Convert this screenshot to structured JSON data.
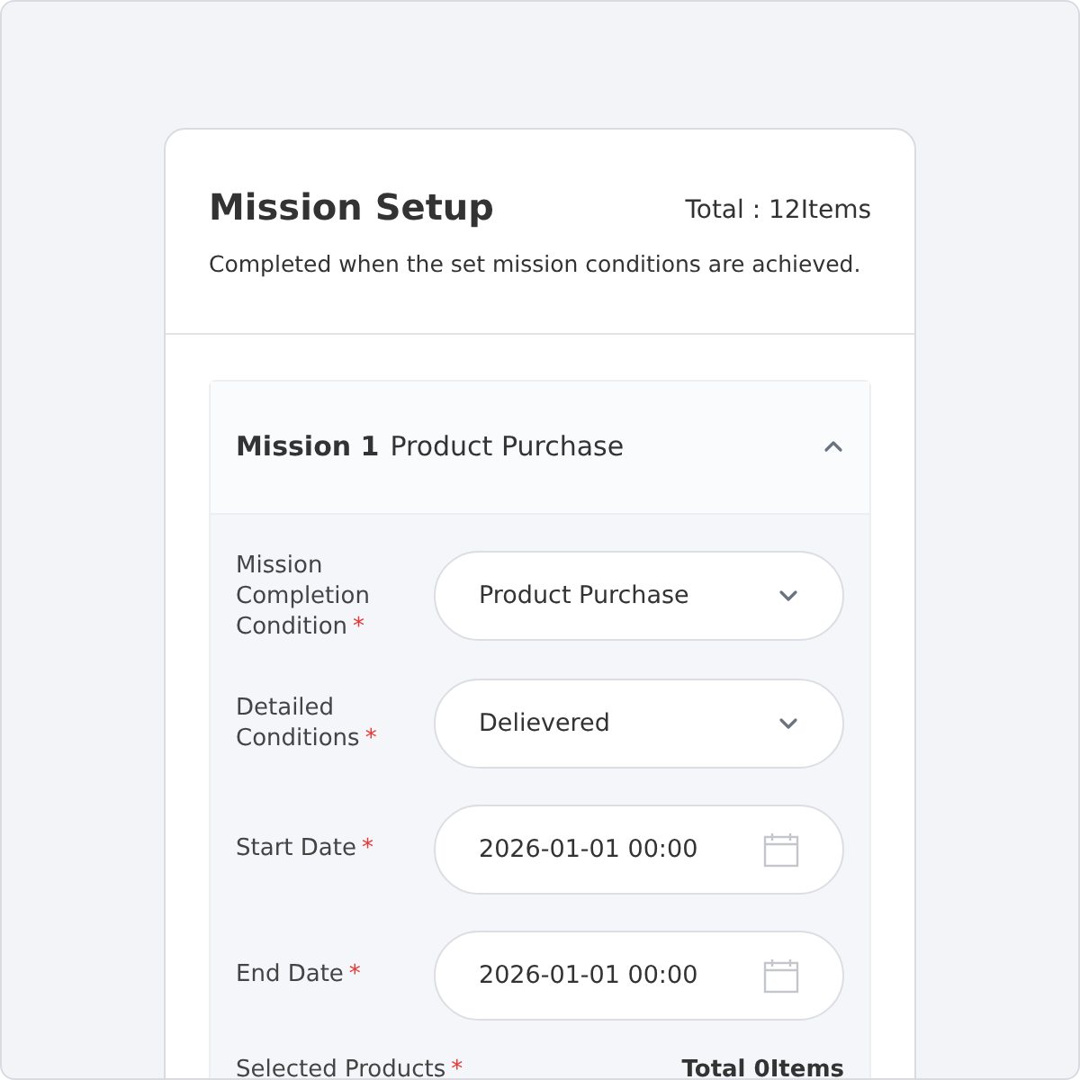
{
  "card": {
    "title": "Mission Setup",
    "total": "Total : 12Items",
    "description": "Completed when the set mission conditions are achieved."
  },
  "mission": {
    "number": "Mission 1",
    "name": "Product Purchase",
    "expanded": true,
    "fields": [
      {
        "kind": "select",
        "label": "Mission Completion Condition",
        "required_mark": "*",
        "value": "Product Purchase"
      },
      {
        "kind": "select",
        "label": "Detailed Conditions",
        "required_mark": "*",
        "value": "Delievered"
      },
      {
        "kind": "date",
        "label": "Start Date",
        "required_mark": "*",
        "value": "2026-01-01 00:00"
      },
      {
        "kind": "date",
        "label": "End Date",
        "required_mark": "*",
        "value": "2026-01-01 00:00"
      }
    ],
    "products": {
      "label": "Selected Products",
      "required_mark": "*",
      "total": "Total 0Items"
    }
  }
}
